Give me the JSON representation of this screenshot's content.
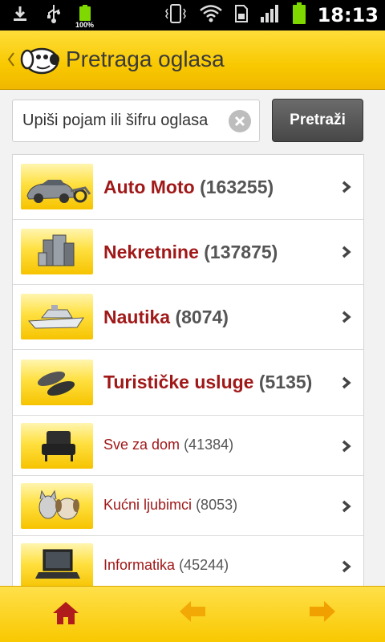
{
  "status_bar": {
    "battery_percent_label": "100%",
    "time": "18:13",
    "icons": [
      "download-icon",
      "usb-icon",
      "battery-charging-icon",
      "vibrate-icon",
      "wifi-icon",
      "sim-icon",
      "signal-icon",
      "battery-icon"
    ]
  },
  "header": {
    "title": "Pretraga oglasa",
    "back_icon": "chevron-left-icon",
    "logo": "dog-logo"
  },
  "search": {
    "placeholder": "Upiši pojam ili šifru oglasa",
    "value": "Upiši pojam ili šifru oglasa",
    "clear_icon": "clear-icon",
    "button_label": "Pretraži"
  },
  "categories": [
    {
      "name": "Auto Moto",
      "count": "(163255)",
      "icon": "car-motorcycle-icon",
      "style": "big"
    },
    {
      "name": "Nekretnine",
      "count": "(137875)",
      "icon": "buildings-icon",
      "style": "big"
    },
    {
      "name": "Nautika",
      "count": "(8074)",
      "icon": "boat-icon",
      "style": "big"
    },
    {
      "name": "Turističke usluge",
      "count": "(5135)",
      "icon": "flip-flops-icon",
      "style": "big"
    },
    {
      "name": "Sve za dom",
      "count": "(41384)",
      "icon": "armchair-icon",
      "style": "small"
    },
    {
      "name": "Kućni ljubimci",
      "count": "(8053)",
      "icon": "pets-icon",
      "style": "small"
    },
    {
      "name": "Informatika",
      "count": "(45244)",
      "icon": "laptop-icon",
      "style": "small"
    }
  ],
  "bottom_nav": {
    "home_icon": "home-icon",
    "back_icon": "arrow-left-icon",
    "forward_icon": "arrow-right-icon"
  },
  "colors": {
    "accent_yellow": "#f8c800",
    "category_red": "#a01818",
    "home_red": "#b01c1c",
    "arrow_orange": "#f0a000"
  }
}
